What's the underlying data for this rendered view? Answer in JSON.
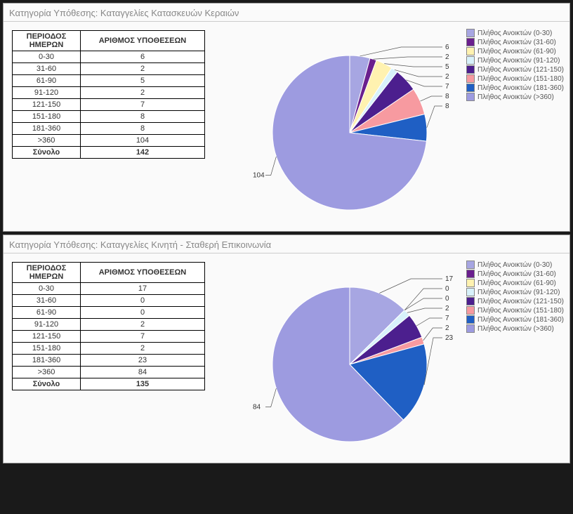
{
  "columns": {
    "period": "ΠΕΡΙΟΔΟΣ ΗΜΕΡΩΝ",
    "count": "ΑΡΙΘΜΟΣ ΥΠΟΘΕΣΕΩΝ",
    "total": "Σύνολο"
  },
  "legend_labels": [
    "Πλήθος Ανοικτών (0-30)",
    "Πλήθος Ανοικτών (31-60)",
    "Πλήθος Ανοικτών (61-90)",
    "Πλήθος Ανοικτών (91-120)",
    "Πλήθος Ανοικτών (121-150)",
    "Πλήθος Ανοικτών (151-180)",
    "Πλήθος Ανοικτών (181-360)",
    "Πλήθος Ανοικτών (>360)"
  ],
  "colors": [
    "#a7a6e2",
    "#6a1f8e",
    "#fff2b0",
    "#d8f2fb",
    "#4c1f8e",
    "#f79aa0",
    "#1f5fc4",
    "#9d9be0"
  ],
  "panels": [
    {
      "title": "Κατηγορία Υπόθεσης: Καταγγελίες Κατασκευών Κεραιών",
      "rows": [
        {
          "period": "0-30",
          "count": 6
        },
        {
          "period": "31-60",
          "count": 2
        },
        {
          "period": "61-90",
          "count": 5
        },
        {
          "period": "91-120",
          "count": 2
        },
        {
          "period": "121-150",
          "count": 7
        },
        {
          "period": "151-180",
          "count": 8
        },
        {
          "period": "181-360",
          "count": 8
        },
        {
          "period": ">360",
          "count": 104
        }
      ],
      "total": 142
    },
    {
      "title": "Κατηγορία Υπόθεσης: Καταγγελίες Κινητή - Σταθερή Επικοινωνία",
      "rows": [
        {
          "period": "0-30",
          "count": 17
        },
        {
          "period": "31-60",
          "count": 0
        },
        {
          "period": "61-90",
          "count": 0
        },
        {
          "period": "91-120",
          "count": 2
        },
        {
          "period": "121-150",
          "count": 7
        },
        {
          "period": "151-180",
          "count": 2
        },
        {
          "period": "181-360",
          "count": 23
        },
        {
          "period": ">360",
          "count": 84
        }
      ],
      "total": 135
    }
  ],
  "chart_data": [
    {
      "type": "pie",
      "title": "Κατηγορία Υπόθεσης: Καταγγελίες Κατασκευών Κεραιών",
      "categories": [
        "0-30",
        "31-60",
        "61-90",
        "91-120",
        "121-150",
        "151-180",
        "181-360",
        ">360"
      ],
      "values": [
        6,
        2,
        5,
        2,
        7,
        8,
        8,
        104
      ],
      "total": 142
    },
    {
      "type": "pie",
      "title": "Κατηγορία Υπόθεσης: Καταγγελίες Κινητή - Σταθερή Επικοινωνία",
      "categories": [
        "0-30",
        "31-60",
        "61-90",
        "91-120",
        "121-150",
        "151-180",
        "181-360",
        ">360"
      ],
      "values": [
        17,
        0,
        0,
        2,
        7,
        2,
        23,
        84
      ],
      "total": 135
    }
  ]
}
